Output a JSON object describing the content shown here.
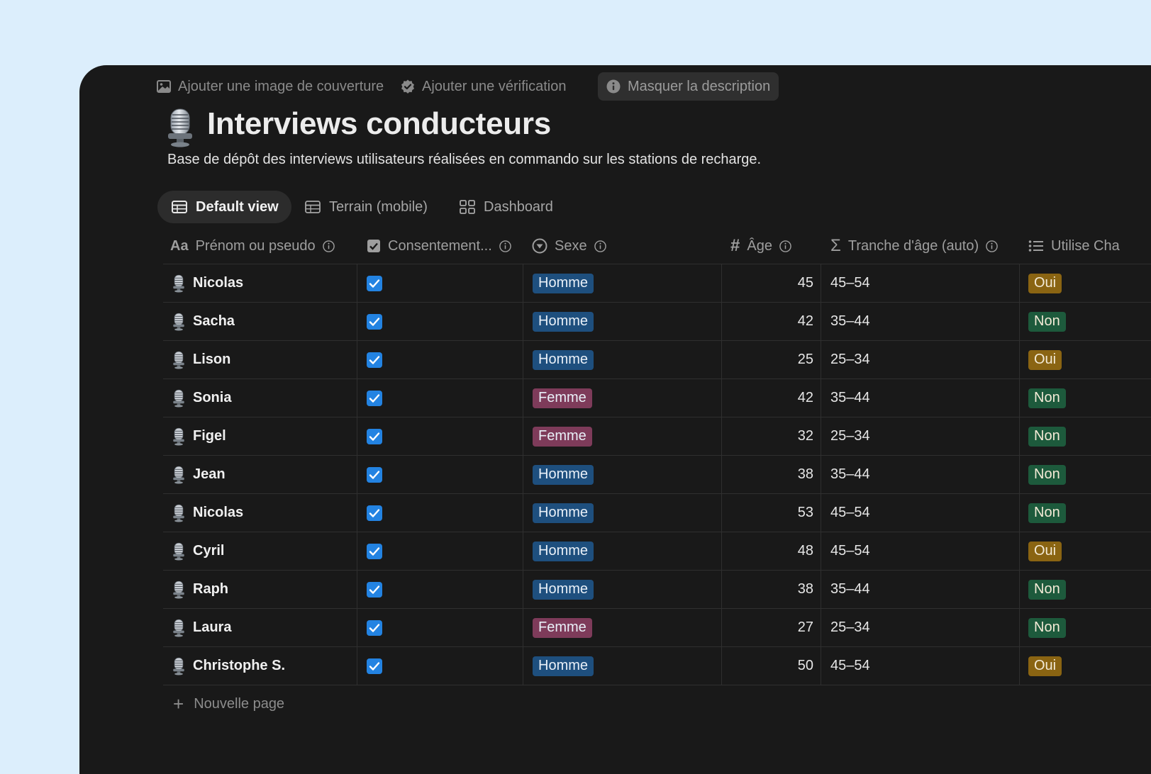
{
  "toolbar": {
    "add_cover": "Ajouter une image de couverture",
    "add_verification": "Ajouter une vérification",
    "hide_description": "Masquer la description"
  },
  "page": {
    "icon": "microphone-icon",
    "title": "Interviews conducteurs",
    "description": "Base de dépôt des interviews utilisateurs réalisées en commando sur les stations de recharge."
  },
  "views": [
    {
      "label": "Default view",
      "icon": "table-icon",
      "active": true
    },
    {
      "label": "Terrain (mobile)",
      "icon": "table-icon",
      "active": false
    },
    {
      "label": "Dashboard",
      "icon": "dashboard-icon",
      "active": false
    }
  ],
  "columns": {
    "name": "Prénom ou pseudo",
    "consent": "Consentement...",
    "sex": "Sexe",
    "age": "Âge",
    "age_range": "Tranche d'âge (auto)",
    "uses": "Utilise Cha"
  },
  "colors": {
    "homme_tag": "#1e4f7e",
    "femme_tag": "#7e3b5a",
    "oui_tag": "#8a6412",
    "non_tag": "#1d5a3c",
    "checkbox": "#2383e2"
  },
  "rows": [
    {
      "name": "Nicolas",
      "consent": true,
      "sex": "Homme",
      "age": "45",
      "range": "45–54",
      "uses": "Oui"
    },
    {
      "name": "Sacha",
      "consent": true,
      "sex": "Homme",
      "age": "42",
      "range": "35–44",
      "uses": "Non"
    },
    {
      "name": "Lison",
      "consent": true,
      "sex": "Homme",
      "age": "25",
      "range": "25–34",
      "uses": "Oui"
    },
    {
      "name": "Sonia",
      "consent": true,
      "sex": "Femme",
      "age": "42",
      "range": "35–44",
      "uses": "Non"
    },
    {
      "name": "Figel",
      "consent": true,
      "sex": "Femme",
      "age": "32",
      "range": "25–34",
      "uses": "Non"
    },
    {
      "name": "Jean",
      "consent": true,
      "sex": "Homme",
      "age": "38",
      "range": "35–44",
      "uses": "Non"
    },
    {
      "name": "Nicolas",
      "consent": true,
      "sex": "Homme",
      "age": "53",
      "range": "45–54",
      "uses": "Non"
    },
    {
      "name": "Cyril",
      "consent": true,
      "sex": "Homme",
      "age": "48",
      "range": "45–54",
      "uses": "Oui"
    },
    {
      "name": "Raph",
      "consent": true,
      "sex": "Homme",
      "age": "38",
      "range": "35–44",
      "uses": "Non"
    },
    {
      "name": "Laura",
      "consent": true,
      "sex": "Femme",
      "age": "27",
      "range": "25–34",
      "uses": "Non"
    },
    {
      "name": "Christophe S.",
      "consent": true,
      "sex": "Homme",
      "age": "50",
      "range": "45–54",
      "uses": "Oui"
    }
  ],
  "new_page_label": "Nouvelle page"
}
